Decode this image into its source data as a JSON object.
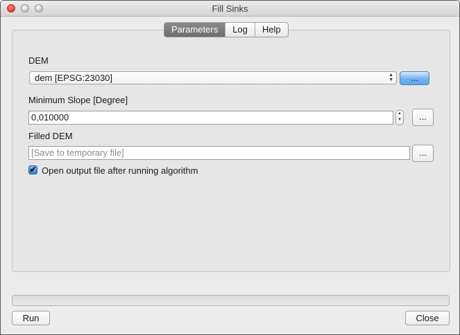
{
  "window": {
    "title": "Fill Sinks"
  },
  "tabs": [
    {
      "label": "Parameters",
      "active": true
    },
    {
      "label": "Log",
      "active": false
    },
    {
      "label": "Help",
      "active": false
    }
  ],
  "params": {
    "dem": {
      "label": "DEM",
      "value": "dem [EPSG:23030]",
      "browse": "..."
    },
    "min_slope": {
      "label": "Minimum Slope [Degree]",
      "value": "0,010000",
      "browse": "..."
    },
    "filled_dem": {
      "label": "Filled DEM",
      "placeholder": "[Save to temporary file]",
      "value": "",
      "browse": "..."
    },
    "open_output": {
      "label": "Open output file after running algorithm",
      "checked": true
    }
  },
  "progress": {
    "value": 0
  },
  "buttons": {
    "run": "Run",
    "close": "Close"
  },
  "icons": {
    "checkbox_mark": "✔",
    "spinner_up": "▲",
    "spinner_down": "▼",
    "select_arrows": "▲▼"
  },
  "colors": {
    "accent": "#5ea5ea",
    "active_tab": "#7a7a7a"
  }
}
